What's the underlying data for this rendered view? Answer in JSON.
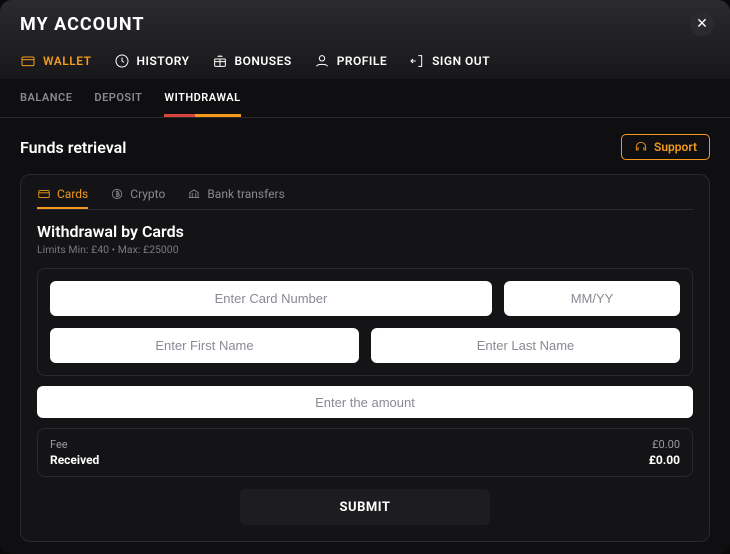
{
  "header": {
    "title": "MY ACCOUNT",
    "tabs": [
      {
        "label": "WALLET",
        "icon": "wallet-icon",
        "active": true
      },
      {
        "label": "HISTORY",
        "icon": "history-icon",
        "active": false
      },
      {
        "label": "BONUSES",
        "icon": "bonus-icon",
        "active": false
      },
      {
        "label": "PROFILE",
        "icon": "profile-icon",
        "active": false
      },
      {
        "label": "SIGN OUT",
        "icon": "signout-icon",
        "active": false
      }
    ]
  },
  "subTabs": [
    {
      "label": "BALANCE",
      "active": false
    },
    {
      "label": "DEPOSIT",
      "active": false
    },
    {
      "label": "WITHDRAWAL",
      "active": true
    }
  ],
  "sectionTitle": "Funds retrieval",
  "supportLabel": "Support",
  "paymentTabs": [
    {
      "label": "Cards",
      "icon": "card-icon",
      "active": true
    },
    {
      "label": "Crypto",
      "icon": "crypto-icon",
      "active": false
    },
    {
      "label": "Bank transfers",
      "icon": "bank-icon",
      "active": false
    }
  ],
  "form": {
    "title": "Withdrawal by Cards",
    "limitsText": "Limits Min: £40 • Max: £25000",
    "cardNumberPlaceholder": "Enter Card Number",
    "expiryPlaceholder": "MM/YY",
    "firstNamePlaceholder": "Enter First Name",
    "lastNamePlaceholder": "Enter Last Name",
    "amountPlaceholder": "Enter the amount",
    "feeLabel": "Fee",
    "feeValue": "£0.00",
    "receivedLabel": "Received",
    "receivedValue": "£0.00",
    "submitLabel": "SUBMIT"
  }
}
